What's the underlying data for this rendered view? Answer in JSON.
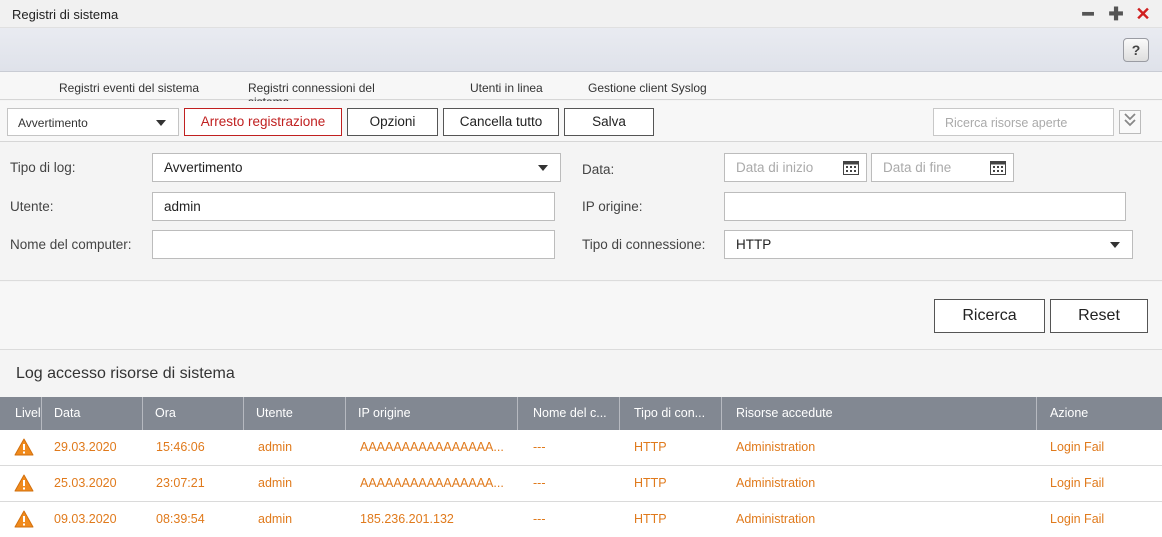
{
  "window": {
    "title": "Registri di sistema",
    "help_label": "?",
    "minimize_glyph": "━",
    "maximize_glyph": "✚",
    "close_glyph": "✕"
  },
  "tabs": [
    {
      "label": "Registri eventi del sistema",
      "active": false
    },
    {
      "label": "Registri connessioni del sistema",
      "active": true
    },
    {
      "label": "Utenti in linea",
      "active": false
    },
    {
      "label": "Gestione client Syslog",
      "active": false
    }
  ],
  "toolbar": {
    "level_select": "Avvertimento",
    "stop_label": "Arresto registrazione",
    "options_label": "Opzioni",
    "clear_label": "Cancella tutto",
    "save_label": "Salva",
    "search_placeholder": "Ricerca risorse aperte"
  },
  "filters": {
    "log_type_label": "Tipo di log:",
    "log_type_value": "Avvertimento",
    "user_label": "Utente:",
    "user_value": "admin",
    "computer_label": "Nome del computer:",
    "computer_value": "",
    "date_label": "Data:",
    "start_date_placeholder": "Data di inizio",
    "end_date_placeholder": "Data di fine",
    "source_ip_label": "IP origine:",
    "source_ip_value": "",
    "connection_type_label": "Tipo di connessione:",
    "connection_type_value": "HTTP",
    "search_label": "Ricerca",
    "reset_label": "Reset"
  },
  "table": {
    "title": "Log accesso risorse di sistema",
    "columns": [
      "Livel",
      "Data",
      "Ora",
      "Utente",
      "IP origine",
      "Nome del c...",
      "Tipo di con...",
      "Risorse accedute",
      "Azione"
    ],
    "rows": [
      {
        "level": "warning",
        "date": "29.03.2020",
        "time": "15:46:06",
        "user": "admin",
        "ip": "AAAAAAAAAAAAAAAA...",
        "computer": "---",
        "conn": "HTTP",
        "resource": "Administration",
        "action": "Login Fail"
      },
      {
        "level": "warning",
        "date": "25.03.2020",
        "time": "23:07:21",
        "user": "admin",
        "ip": "AAAAAAAAAAAAAAAA...",
        "computer": "---",
        "conn": "HTTP",
        "resource": "Administration",
        "action": "Login Fail"
      },
      {
        "level": "warning",
        "date": "09.03.2020",
        "time": "08:39:54",
        "user": "admin",
        "ip": "185.236.201.132",
        "computer": "---",
        "conn": "HTTP",
        "resource": "Administration",
        "action": "Login Fail"
      }
    ]
  },
  "colors": {
    "accent": "#e07a1c",
    "header_bg": "#828892",
    "stop_red": "#c02020",
    "warning": "#f08a1c"
  }
}
